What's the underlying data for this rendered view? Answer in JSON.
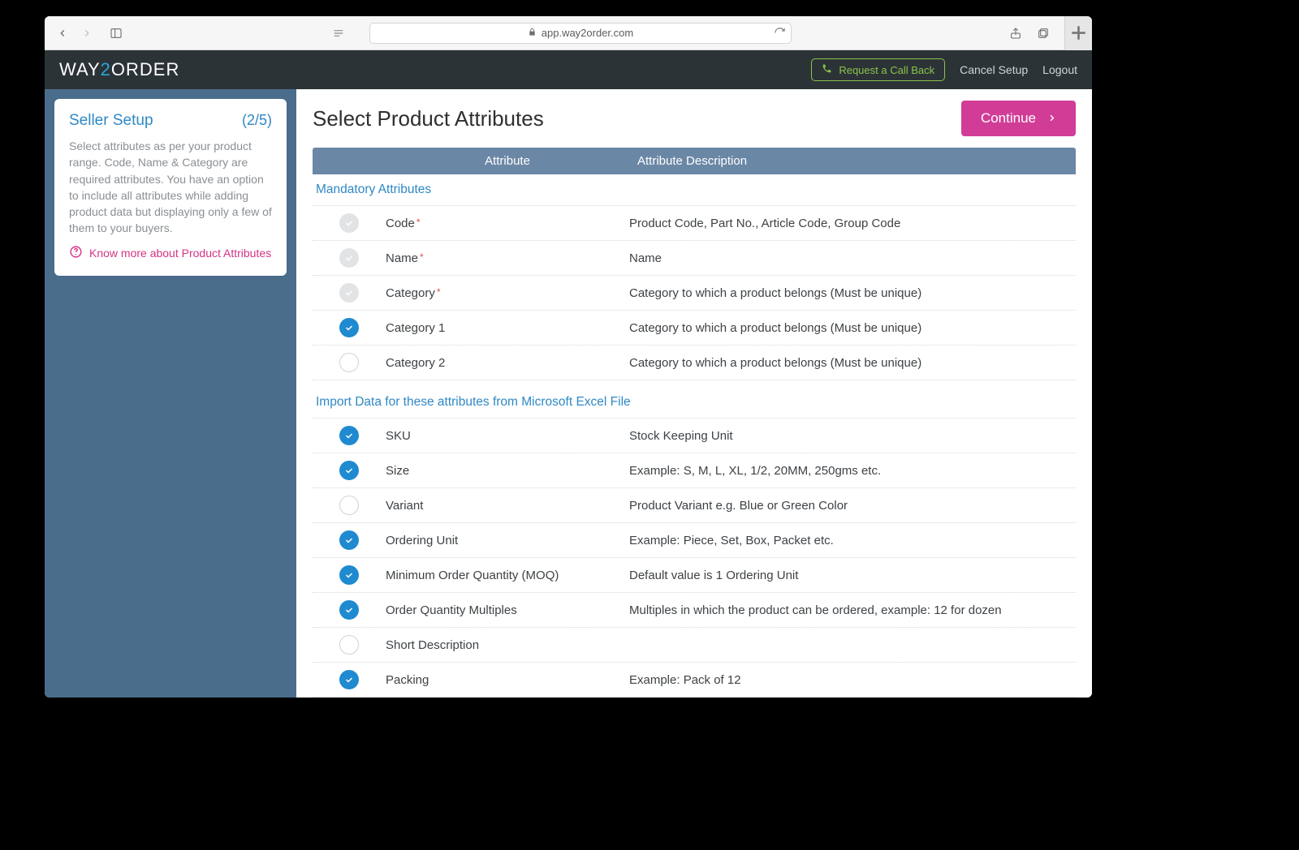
{
  "browser": {
    "url_host": "app.way2order.com"
  },
  "logo": {
    "pre": "WAY",
    "mid": "2",
    "post": "ORDER"
  },
  "header": {
    "call_back": "Request a Call Back",
    "cancel": "Cancel Setup",
    "logout": "Logout"
  },
  "sidebar": {
    "title": "Seller Setup",
    "step": "(2/5)",
    "text": "Select attributes as per your product range. Code, Name & Category are required attributes. You have an option to include all attributes while adding product data but displaying only a few of them to your buyers.",
    "know_more": "Know more about Product Attributes"
  },
  "main": {
    "title": "Select Product Attributes",
    "continue": "Continue",
    "th_attr": "Attribute",
    "th_desc": "Attribute Description",
    "section1": "Mandatory Attributes",
    "section2": "Import Data for these attributes from Microsoft Excel File"
  },
  "mandatory": [
    {
      "state": "locked",
      "name": "Code",
      "req": true,
      "desc": "Product Code, Part No., Article Code, Group Code"
    },
    {
      "state": "locked",
      "name": "Name",
      "req": true,
      "desc": "Name"
    },
    {
      "state": "locked",
      "name": "Category",
      "req": true,
      "desc": "Category to which a product belongs (Must be unique)"
    },
    {
      "state": "on",
      "name": "Category 1",
      "req": false,
      "desc": "Category to which a product belongs (Must be unique)"
    },
    {
      "state": "off",
      "name": "Category 2",
      "req": false,
      "desc": "Category to which a product belongs (Must be unique)"
    }
  ],
  "import": [
    {
      "state": "on",
      "name": "SKU",
      "desc": "Stock Keeping Unit"
    },
    {
      "state": "on",
      "name": "Size",
      "desc": "Example: S, M, L, XL, 1/2, 20MM, 250gms etc."
    },
    {
      "state": "off",
      "name": "Variant",
      "desc": "Product Variant e.g. Blue or Green Color"
    },
    {
      "state": "on",
      "name": "Ordering Unit",
      "desc": "Example: Piece, Set, Box, Packet etc."
    },
    {
      "state": "on",
      "name": "Minimum Order Quantity (MOQ)",
      "desc": "Default value is 1 Ordering Unit"
    },
    {
      "state": "on",
      "name": "Order Quantity Multiples",
      "desc": "Multiples in which the product can be ordered, example: 12 for dozen"
    },
    {
      "state": "off",
      "name": "Short Description",
      "desc": ""
    },
    {
      "state": "on",
      "name": "Packing",
      "desc": "Example: Pack of 12"
    }
  ]
}
